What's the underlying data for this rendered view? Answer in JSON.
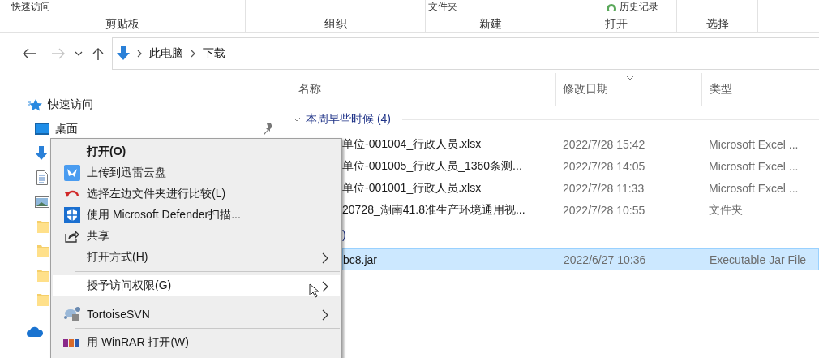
{
  "ribbon": {
    "groups": [
      {
        "label": "剪贴板",
        "top": "快速访问"
      },
      {
        "label": "组织"
      },
      {
        "label": "新建",
        "top": "文件夹"
      },
      {
        "label": "打开",
        "top": "历史记录"
      },
      {
        "label": "选择"
      }
    ]
  },
  "nav": {
    "back_disabled": false,
    "forward_disabled": true,
    "path": [
      "此电脑",
      "下载"
    ]
  },
  "sidebar": {
    "items": [
      {
        "label": "快速访问",
        "pinned": false
      },
      {
        "label": "桌面",
        "pinned": true
      },
      {
        "pinned": false
      },
      {
        "pinned": false
      },
      {
        "pinned": false
      },
      {
        "pinned": false
      },
      {
        "pinned": false
      },
      {
        "pinned": false
      },
      {
        "pinned": false
      },
      {
        "pinned": false
      }
    ]
  },
  "files": {
    "columns": [
      {
        "label": "名称",
        "sorted": false
      },
      {
        "label": "修改日期",
        "sorted": true
      },
      {
        "label": "类型",
        "sorted": false
      }
    ],
    "groups": [
      {
        "kind": "full",
        "label": "本周早些时候 (4)",
        "expanded": true,
        "rows": [
          {
            "name": "单位-001004_行政人员.xlsx",
            "date": "2022/7/28 15:42",
            "type": "Microsoft Excel ...",
            "selected": false
          },
          {
            "name": "单位-001005_行政人员_1360条测...",
            "date": "2022/7/28 14:05",
            "type": "Microsoft Excel ...",
            "selected": false
          },
          {
            "name": "单位-001001_行政人员.xlsx",
            "date": "2022/7/28 11:33",
            "type": "Microsoft Excel ...",
            "selected": false
          },
          {
            "name": "20728_湖南41.8准生产环境通用视...",
            "date": "2022/7/28 10:55",
            "type": "文件夹",
            "selected": false
          }
        ]
      },
      {
        "kind": "clipped",
        "label": ")",
        "rows": [
          {
            "name": "bc8.jar",
            "date": "2022/6/27 10:36",
            "type": "Executable Jar File",
            "selected": true
          }
        ]
      }
    ]
  },
  "context_menu": {
    "items": [
      {
        "kind": "item",
        "label": "打开(O)",
        "bold": true,
        "submenu": false,
        "highlighted": false
      },
      {
        "kind": "item",
        "label": "上传到迅雷云盘",
        "bold": false,
        "submenu": false,
        "highlighted": false
      },
      {
        "kind": "item",
        "label": "选择左边文件夹进行比较(L)",
        "bold": false,
        "submenu": false,
        "highlighted": false
      },
      {
        "kind": "item",
        "label": "使用 Microsoft Defender扫描...",
        "bold": false,
        "submenu": false,
        "highlighted": false
      },
      {
        "kind": "item",
        "label": "共享",
        "bold": false,
        "submenu": false,
        "highlighted": false
      },
      {
        "kind": "item",
        "label": "打开方式(H)",
        "bold": false,
        "submenu": true,
        "highlighted": false
      },
      {
        "kind": "separator"
      },
      {
        "kind": "item",
        "label": "授予访问权限(G)",
        "bold": false,
        "submenu": true,
        "highlighted": true
      },
      {
        "kind": "separator"
      },
      {
        "kind": "item",
        "label": "TortoiseSVN",
        "bold": false,
        "submenu": true,
        "highlighted": false
      },
      {
        "kind": "separator"
      },
      {
        "kind": "item",
        "label": "用 WinRAR 打开(W)",
        "bold": false,
        "submenu": false,
        "highlighted": false
      }
    ]
  }
}
